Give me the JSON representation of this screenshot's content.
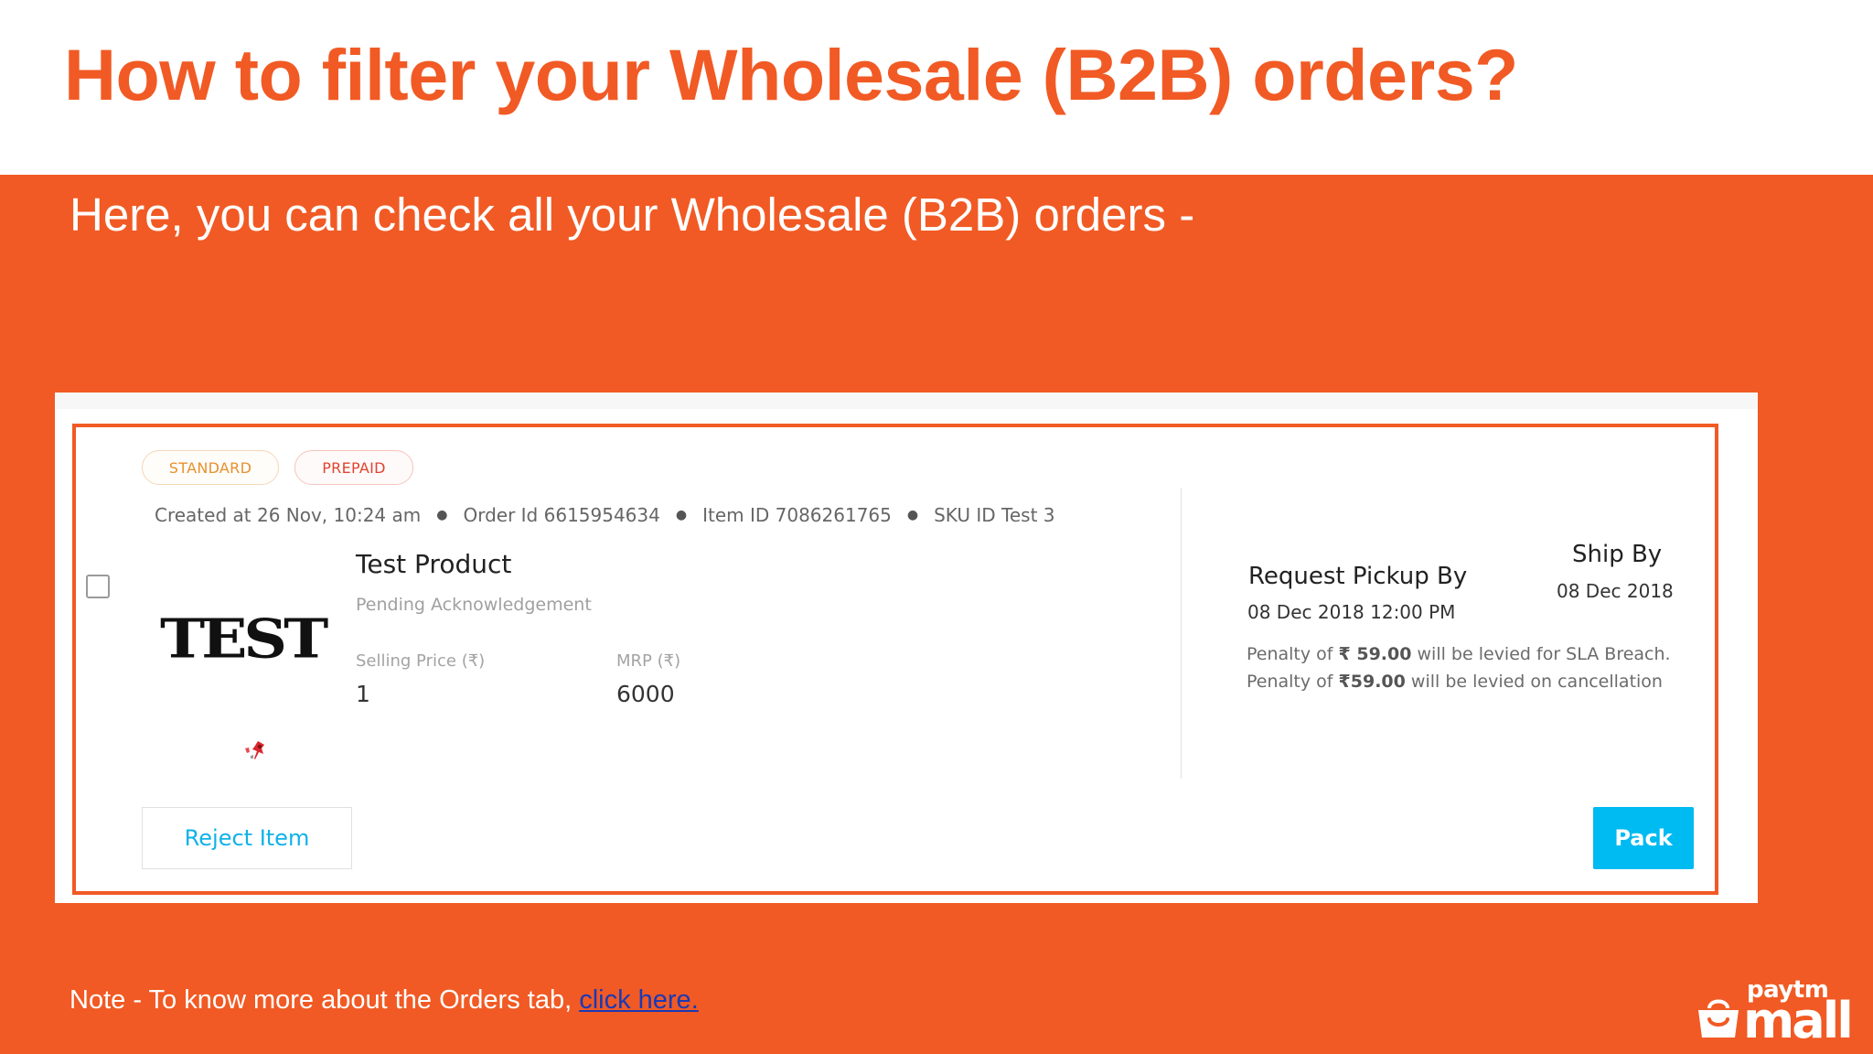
{
  "slide": {
    "title": "How to filter your Wholesale (B2B) orders?",
    "subtitle": "Here, you can check all your Wholesale (B2B) orders -"
  },
  "order_card": {
    "tags": [
      "STANDARD",
      "PREPAID"
    ],
    "meta": {
      "created": "Created at 26 Nov, 10:24 am",
      "order_id": "Order Id 6615954634",
      "item_id": "Item ID 7086261765",
      "sku_id": "SKU ID Test 3"
    },
    "product": {
      "image_text": "TEST",
      "name": "Test Product",
      "status": "Pending Acknowledgement",
      "selling_price_label": "Selling Price (₹)",
      "selling_price": "1",
      "mrp_label": "MRP (₹)",
      "mrp": "6000"
    },
    "pickup": {
      "label": "Request Pickup By",
      "date": "08 Dec 2018 12:00 PM"
    },
    "ship_by": {
      "label": "Ship By",
      "date": "08 Dec 2018"
    },
    "penalty_sla": {
      "prefix": "Penalty of",
      "amount": "₹ 59.00",
      "suffix": "will be levied for SLA Breach."
    },
    "penalty_cancel": {
      "prefix": "Penalty of",
      "amount": "₹59.00",
      "suffix": "will be levied on cancellation"
    },
    "actions": {
      "reject": "Reject Item",
      "pack": "Pack"
    }
  },
  "footer": {
    "note": "Note - To know more about the Orders tab,",
    "link": "click here.",
    "brand_top": "paytm",
    "brand_bottom": "mall"
  },
  "colors": {
    "accent_orange": "#f15a24",
    "pack_blue": "#00baf2",
    "link_blue": "#1a39b5"
  }
}
